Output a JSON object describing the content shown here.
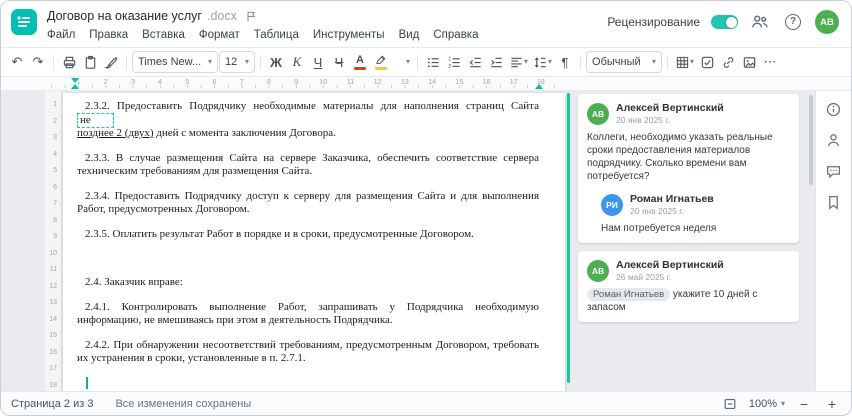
{
  "header": {
    "title": "Договор на оказание услуг",
    "title_ext": ".docx",
    "review_label": "Рецензирование",
    "help_glyph": "?",
    "user_initials": "АВ",
    "user_color": "#4caf50"
  },
  "menus": [
    {
      "label": "Файл",
      "slug": "file"
    },
    {
      "label": "Правка",
      "slug": "edit"
    },
    {
      "label": "Вставка",
      "slug": "insert"
    },
    {
      "label": "Формат",
      "slug": "format"
    },
    {
      "label": "Таблица",
      "slug": "table"
    },
    {
      "label": "Инструменты",
      "slug": "tools"
    },
    {
      "label": "Вид",
      "slug": "view"
    },
    {
      "label": "Справка",
      "slug": "help"
    }
  ],
  "icons": {
    "undo": "↶",
    "redo": "↷",
    "chevron": "▾",
    "pilcrow": "¶",
    "more": "⋯"
  },
  "toolbar": {
    "font_family": "Times New...",
    "font_size": "12",
    "bold": "Ж",
    "italic": "К",
    "underline": "Ч",
    "strikethrough": "Ч",
    "font_color_letter": "А",
    "font_color_swatch": "#e03e2d",
    "highlight_swatch": "#f6c744",
    "style_name": "Обычный"
  },
  "accent_color": "#00bfb4",
  "ruler": {
    "horizontal": [
      1,
      2,
      3,
      4,
      5,
      6,
      7,
      8,
      9,
      10,
      11,
      12,
      13,
      14,
      15,
      16,
      17,
      18
    ],
    "vertical": [
      1,
      2,
      3,
      4,
      5,
      6,
      7,
      8,
      9,
      10,
      11,
      12,
      13,
      14,
      15,
      16,
      17,
      18
    ]
  },
  "document": {
    "paragraphs": [
      {
        "runs": [
          {
            "t": "2.3.2. Предоставить Подрядчику необходимые материалы для наполнения страниц Сайта "
          },
          {
            "t": "не",
            "box": true
          },
          {
            "br": true
          },
          {
            "t": "позднее 2 (двух)",
            "u": true
          },
          {
            "t": " дней с момента заключения Договора."
          }
        ]
      },
      {
        "runs": [
          {
            "t": "2.3.3. В случае размещения Сайта на сервере Заказчика, обеспечить соответствие сервера техническим требованиям для размещения Сайта."
          }
        ]
      },
      {
        "runs": [
          {
            "t": "2.3.4. Предоставить Подрядчику доступ к серверу для размещения Сайта и для выполнения Работ, предусмотренных Договором."
          }
        ]
      },
      {
        "runs": [
          {
            "t": "2.3.5. Оплатить результат Работ в порядке и в сроки, предусмотренные Договором."
          }
        ]
      },
      {
        "blank": true
      },
      {
        "runs": [
          {
            "t": "2.4. Заказчик вправе:"
          }
        ]
      },
      {
        "runs": [
          {
            "t": "2.4.1. Контролировать выполнение Работ, запрашивать у Подрядчика необходимую информацию, не вмешиваясь при этом в деятельность Подрядчика."
          }
        ]
      },
      {
        "runs": [
          {
            "t": "2.4.2. При обнаружении несоответствий требованиям, предусмотренным Договором, требовать их устранения в сроки, установленные в п. 2.7.1."
          }
        ]
      }
    ]
  },
  "comments": {
    "threads": [
      {
        "items": [
          {
            "initials": "АВ",
            "color": "#4caf50",
            "name": "Алексей Вертинский",
            "date": "20 янв 2025 г.",
            "text": "Коллеги, необходимо указать реальные сроки предоставления материалов подрядчику. Сколько времени вам потребуется?"
          },
          {
            "initials": "РИ",
            "color": "#3e97e6",
            "name": "Роман Игнатьев",
            "date": "20 янв 2025 г.",
            "text": "Нам потребуется неделя"
          }
        ]
      },
      {
        "items": [
          {
            "initials": "АВ",
            "color": "#4caf50",
            "name": "Алексей Вертинский",
            "date": "26 май 2025 г.",
            "mention": "Роман Игнатьев",
            "text": "укажите 10 дней с запасом"
          }
        ]
      }
    ]
  },
  "status": {
    "page_label": "Страница 2 из 3",
    "saved_label": "Все изменения сохранены",
    "zoom": "100%",
    "zoom_out": "−",
    "zoom_in": "+"
  }
}
